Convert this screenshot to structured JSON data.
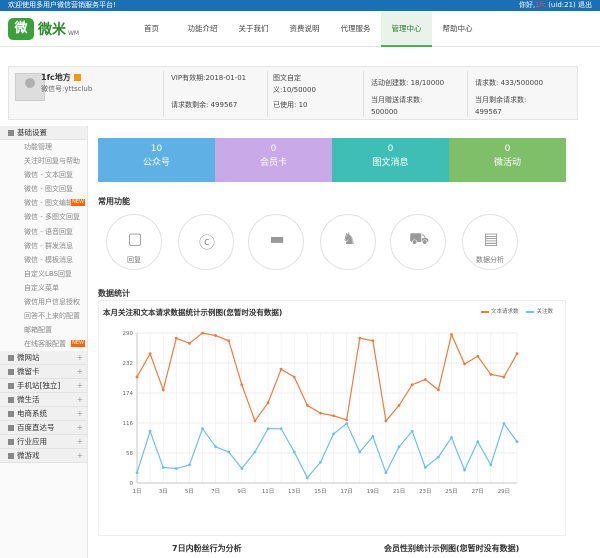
{
  "topbar": {
    "welcome": "欢迎使用多用户微信营销服务平台!",
    "greet": "你好,",
    "user": "1fc",
    "uid": "(uid:21)",
    "logout": "退出"
  },
  "logo": {
    "badge": "微",
    "text": "微米",
    "sub": "WM"
  },
  "nav": [
    {
      "label": "首页"
    },
    {
      "label": "功能介绍"
    },
    {
      "label": "关于我们"
    },
    {
      "label": "资费说明"
    },
    {
      "label": "代理服务"
    },
    {
      "label": "管理中心"
    },
    {
      "label": "帮助中心"
    }
  ],
  "account": {
    "name": "1fc地方",
    "wxid": "微信号:yttsclub",
    "vip_label": "VIP有效期:",
    "vip_date": "2018-01-01",
    "req_left": "请求数剩余: 499567",
    "tw_label": "图文自定义:",
    "tw_value": "10/50000",
    "used": "已使用: 10",
    "activity": "活动创建数: 18/10000",
    "month_req": "当月赠送请求数: 500000",
    "requests": "请求数: 433/500000",
    "month_left": "当月剩余请求数: 499567"
  },
  "sidebar": {
    "basic": "基础设置",
    "items": [
      "功能管理",
      "关注时回复与帮助",
      "微信 - 文本回复",
      "微信 - 图文回复",
      "微信 - 图文编辑器",
      "微信 - 多图文回复",
      "微信 - 语音回复",
      "微信 - 群发消息",
      "微信 - 模板消息",
      "自定义LBS回复",
      "自定义菜单",
      "微信用户信息授权",
      "回答不上来的配置",
      "邮箱配置",
      "在线客服配置"
    ],
    "new_badge": "NEW",
    "groups": [
      "微网站",
      "微留卡",
      "手机站[独立]",
      "微生活",
      "电商系统",
      "百度直达号",
      "行业应用",
      "微游戏"
    ]
  },
  "cards": [
    {
      "num": "10",
      "label": "公众号",
      "color": "#5eb0e5"
    },
    {
      "num": "0",
      "label": "会员卡",
      "color": "#c9a9e8"
    },
    {
      "num": "0",
      "label": "图文消息",
      "color": "#3fbeb6"
    },
    {
      "num": "0",
      "label": "微活动",
      "color": "#7fbf6a"
    }
  ],
  "common": {
    "title": "常用功能",
    "items": [
      {
        "icon": "message-icon",
        "label": "回复"
      },
      {
        "icon": "e-icon",
        "label": ""
      },
      {
        "icon": "card-icon",
        "label": ""
      },
      {
        "icon": "group-icon",
        "label": ""
      },
      {
        "icon": "car-icon",
        "label": ""
      },
      {
        "icon": "bar-chart-icon",
        "label": "数据分析"
      }
    ]
  },
  "data_title": "数据统计",
  "chart_data": {
    "type": "line",
    "title": "本月关注和文本请求数据统计示例图(您暂时没有数据)",
    "x": [
      "1日",
      "2日",
      "3日",
      "4日",
      "5日",
      "6日",
      "7日",
      "8日",
      "9日",
      "10日",
      "11日",
      "12日",
      "13日",
      "14日",
      "15日",
      "16日",
      "17日",
      "18日",
      "19日",
      "20日",
      "21日",
      "22日",
      "23日",
      "24日",
      "25日",
      "26日",
      "27日",
      "28日",
      "29日",
      "30日"
    ],
    "x_tick_labels": [
      "1日",
      "3日",
      "5日",
      "7日",
      "9日",
      "11日",
      "13日",
      "15日",
      "17日",
      "19日",
      "21日",
      "23日",
      "25日",
      "27日",
      "29日"
    ],
    "ylim": [
      0,
      290
    ],
    "yticks": [
      0,
      58,
      116,
      174,
      232,
      290
    ],
    "series": [
      {
        "name": "文本请求数",
        "color": "#f07b3f",
        "values": [
          205,
          250,
          180,
          280,
          270,
          290,
          285,
          275,
          190,
          120,
          155,
          220,
          205,
          150,
          135,
          130,
          122,
          280,
          275,
          120,
          150,
          190,
          200,
          180,
          287,
          230,
          245,
          210,
          205,
          250
        ]
      },
      {
        "name": "关注数",
        "color": "#6cc1ec",
        "values": [
          20,
          100,
          30,
          28,
          35,
          105,
          70,
          60,
          28,
          60,
          105,
          105,
          60,
          10,
          40,
          95,
          115,
          60,
          90,
          20,
          70,
          100,
          30,
          50,
          88,
          25,
          80,
          35,
          115,
          80
        ]
      }
    ],
    "grid": true,
    "legend": "top-right"
  },
  "bottom": {
    "left": "7日内粉丝行为分析",
    "right": "会员性别统计示例图(您暂时没有数据)"
  }
}
